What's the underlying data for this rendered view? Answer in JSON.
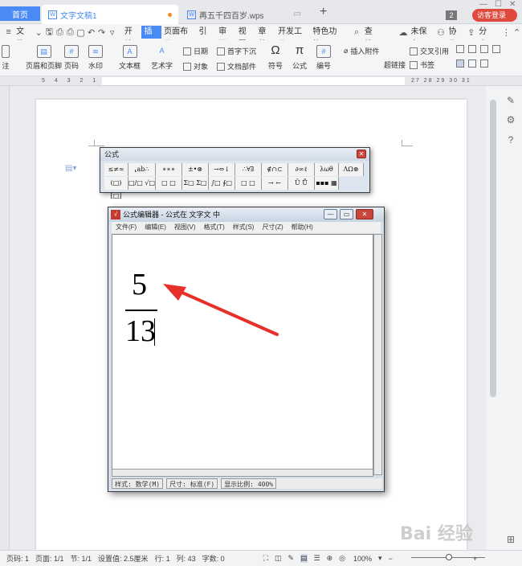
{
  "tabs": {
    "home": "首页",
    "doc1": "文字文稿1",
    "doc2": "再五千四百岁.wps",
    "new_tab": "+",
    "window_count": "2",
    "visitor": "访客登录"
  },
  "menu": {
    "file": "文件",
    "items": [
      "开始",
      "插入",
      "页面布局",
      "引用",
      "审阅",
      "视图",
      "章节",
      "开发工具",
      "特色功能"
    ],
    "active_index": 1,
    "search": "查找",
    "unsaved": "未保存",
    "collab": "协作",
    "share": "分享"
  },
  "ribbon": {
    "header_footer": "页眉和页脚",
    "page_number": "页码",
    "watermark": "水印",
    "textbox": "文本框",
    "wordart": "艺术字",
    "date": "日期",
    "object": "对象",
    "dropcap": "首字下沉",
    "doc_parts": "文档部件",
    "symbol": "符号",
    "formula": "公式",
    "numbering": "编号",
    "insert_attachment": "插入附件",
    "hyperlink": "超链接",
    "cross_ref": "交叉引用",
    "bookmark": "书签",
    "note": "注"
  },
  "ruler_left": "5 4 3 2 1",
  "ruler_right": "27 28 29 30 31",
  "formula_toolbar": {
    "title": "公式",
    "row1": [
      "≤≠≈",
      "⸤ab∴",
      "∗∗∗",
      "±•⊗",
      "→⇔↓",
      "∴∀∃",
      "∉∩⊂",
      "∂∞ℓ",
      "λωθ",
      "ΛΩ⊗"
    ],
    "row2": [
      "(□) [□]",
      "□/□ √□",
      "□ □",
      "Σ□ Σ□",
      "∫□ ∮□",
      "□ □",
      "→ ←",
      "Ū Ů",
      "▪▪▪ ▦"
    ]
  },
  "equation_editor": {
    "title": "公式编辑器 - 公式在 文字文 中",
    "menus": [
      "文件(F)",
      "编辑(E)",
      "视图(V)",
      "格式(T)",
      "样式(S)",
      "尺寸(Z)",
      "帮助(H)"
    ],
    "numerator": "5",
    "denominator": "13",
    "status": {
      "style": "样式: 数学(M)",
      "size": "尺寸: 标准(F)",
      "zoom": "显示比例: 400%"
    }
  },
  "statusbar": {
    "page_num": "页码: 1",
    "pages": "页面: 1/1",
    "section": "节: 1/1",
    "setting": "设置值: 2.5厘米",
    "row": "行: 1",
    "col": "列: 43",
    "words": "字数: 0",
    "zoom": "100%"
  },
  "watermark": "Bai 经验",
  "colors": {
    "accent": "#4a8af4",
    "visitor": "#e04a3e",
    "arrow": "#e8302a"
  }
}
